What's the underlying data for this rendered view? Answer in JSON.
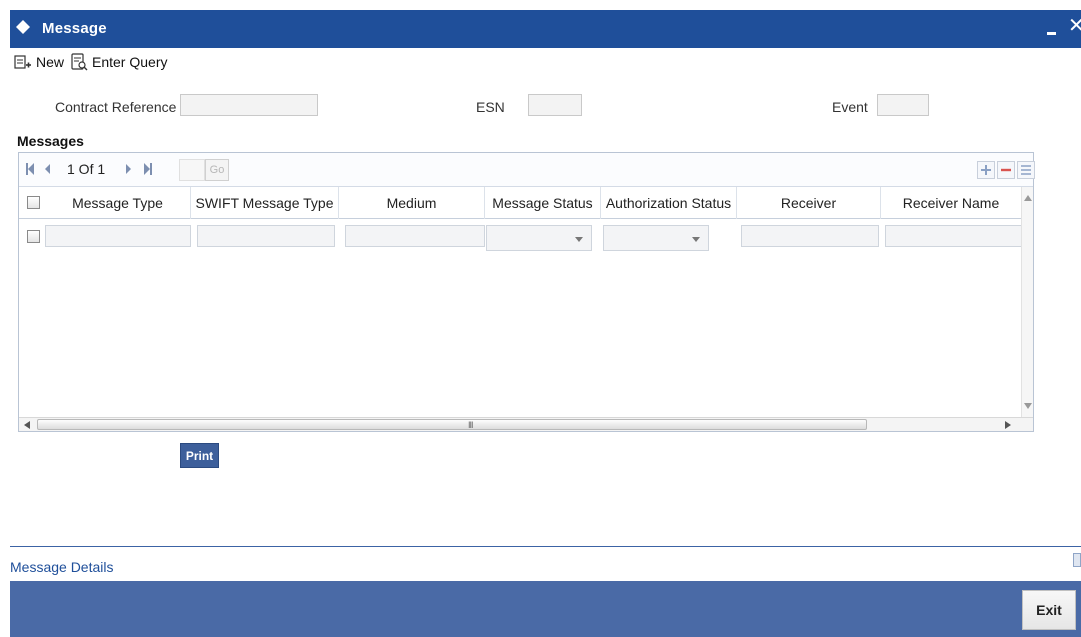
{
  "window": {
    "title": "Message",
    "close_glyph": "✕"
  },
  "toolbar": {
    "new_label": "New",
    "enter_query_label": "Enter Query"
  },
  "header_fields": {
    "contract_reference_label": "Contract Reference",
    "contract_reference_value": "",
    "esn_label": "ESN",
    "esn_value": "",
    "event_label": "Event",
    "event_value": ""
  },
  "messages": {
    "section_title": "Messages",
    "pager_text": "1 Of 1",
    "go_label": "Go",
    "columns": [
      "Message Type",
      "SWIFT Message Type",
      "Medium",
      "Message Status",
      "Authorization Status",
      "Receiver",
      "Receiver Name"
    ],
    "rows": [
      {
        "message_type": "",
        "swift_message_type": "",
        "medium": "",
        "message_status": "",
        "authorization_status": "",
        "receiver": "",
        "receiver_name": ""
      }
    ],
    "hscroll_grip": "III"
  },
  "actions": {
    "print_label": "Print"
  },
  "bottom": {
    "message_details_label": "Message Details",
    "exit_label": "Exit"
  },
  "colors": {
    "titlebar": "#1f4f9a",
    "footer": "#4a6aa6",
    "print_button": "#3d5f9b"
  },
  "icons": [
    "diamond-icon",
    "minimize-icon",
    "close-icon",
    "new-icon",
    "enter-query-icon",
    "first-page-icon",
    "prev-page-icon",
    "next-page-icon",
    "last-page-icon",
    "add-row-icon",
    "delete-row-icon",
    "single-view-icon"
  ]
}
